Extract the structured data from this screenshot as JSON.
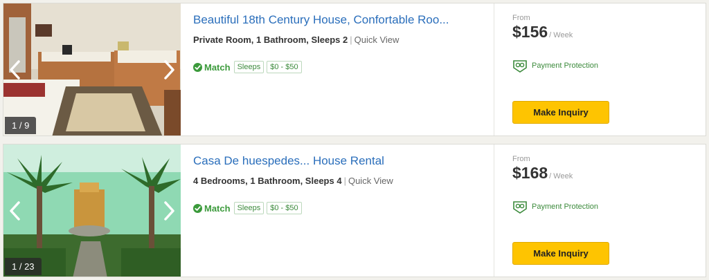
{
  "listings": [
    {
      "title": "Beautiful 18th Century House, Confortable Roo...",
      "features": "Private Room, 1 Bathroom, Sleeps 2",
      "separator": "|",
      "quick_view": "Quick View",
      "match": "Match",
      "tags": [
        "Sleeps",
        "$0 - $50"
      ],
      "photo_counter": "1 / 9",
      "from_label": "From",
      "price": "$156",
      "per": "/ Week",
      "protection": "Payment Protection",
      "inquiry_label": "Make Inquiry",
      "photo_icon": "bedroom-photo"
    },
    {
      "title": "Casa De huespedes... House Rental",
      "features": "4 Bedrooms, 1 Bathroom, Sleeps 4",
      "separator": "|",
      "quick_view": "Quick View",
      "match": "Match",
      "tags": [
        "Sleeps",
        "$0 - $50"
      ],
      "photo_counter": "1 / 23",
      "from_label": "From",
      "price": "$168",
      "per": "/ Week",
      "protection": "Payment Protection",
      "inquiry_label": "Make Inquiry",
      "photo_icon": "garden-photo"
    }
  ],
  "colors": {
    "link": "#2a6ebb",
    "match_green": "#3b9a3b",
    "button_yellow": "#fec401"
  }
}
